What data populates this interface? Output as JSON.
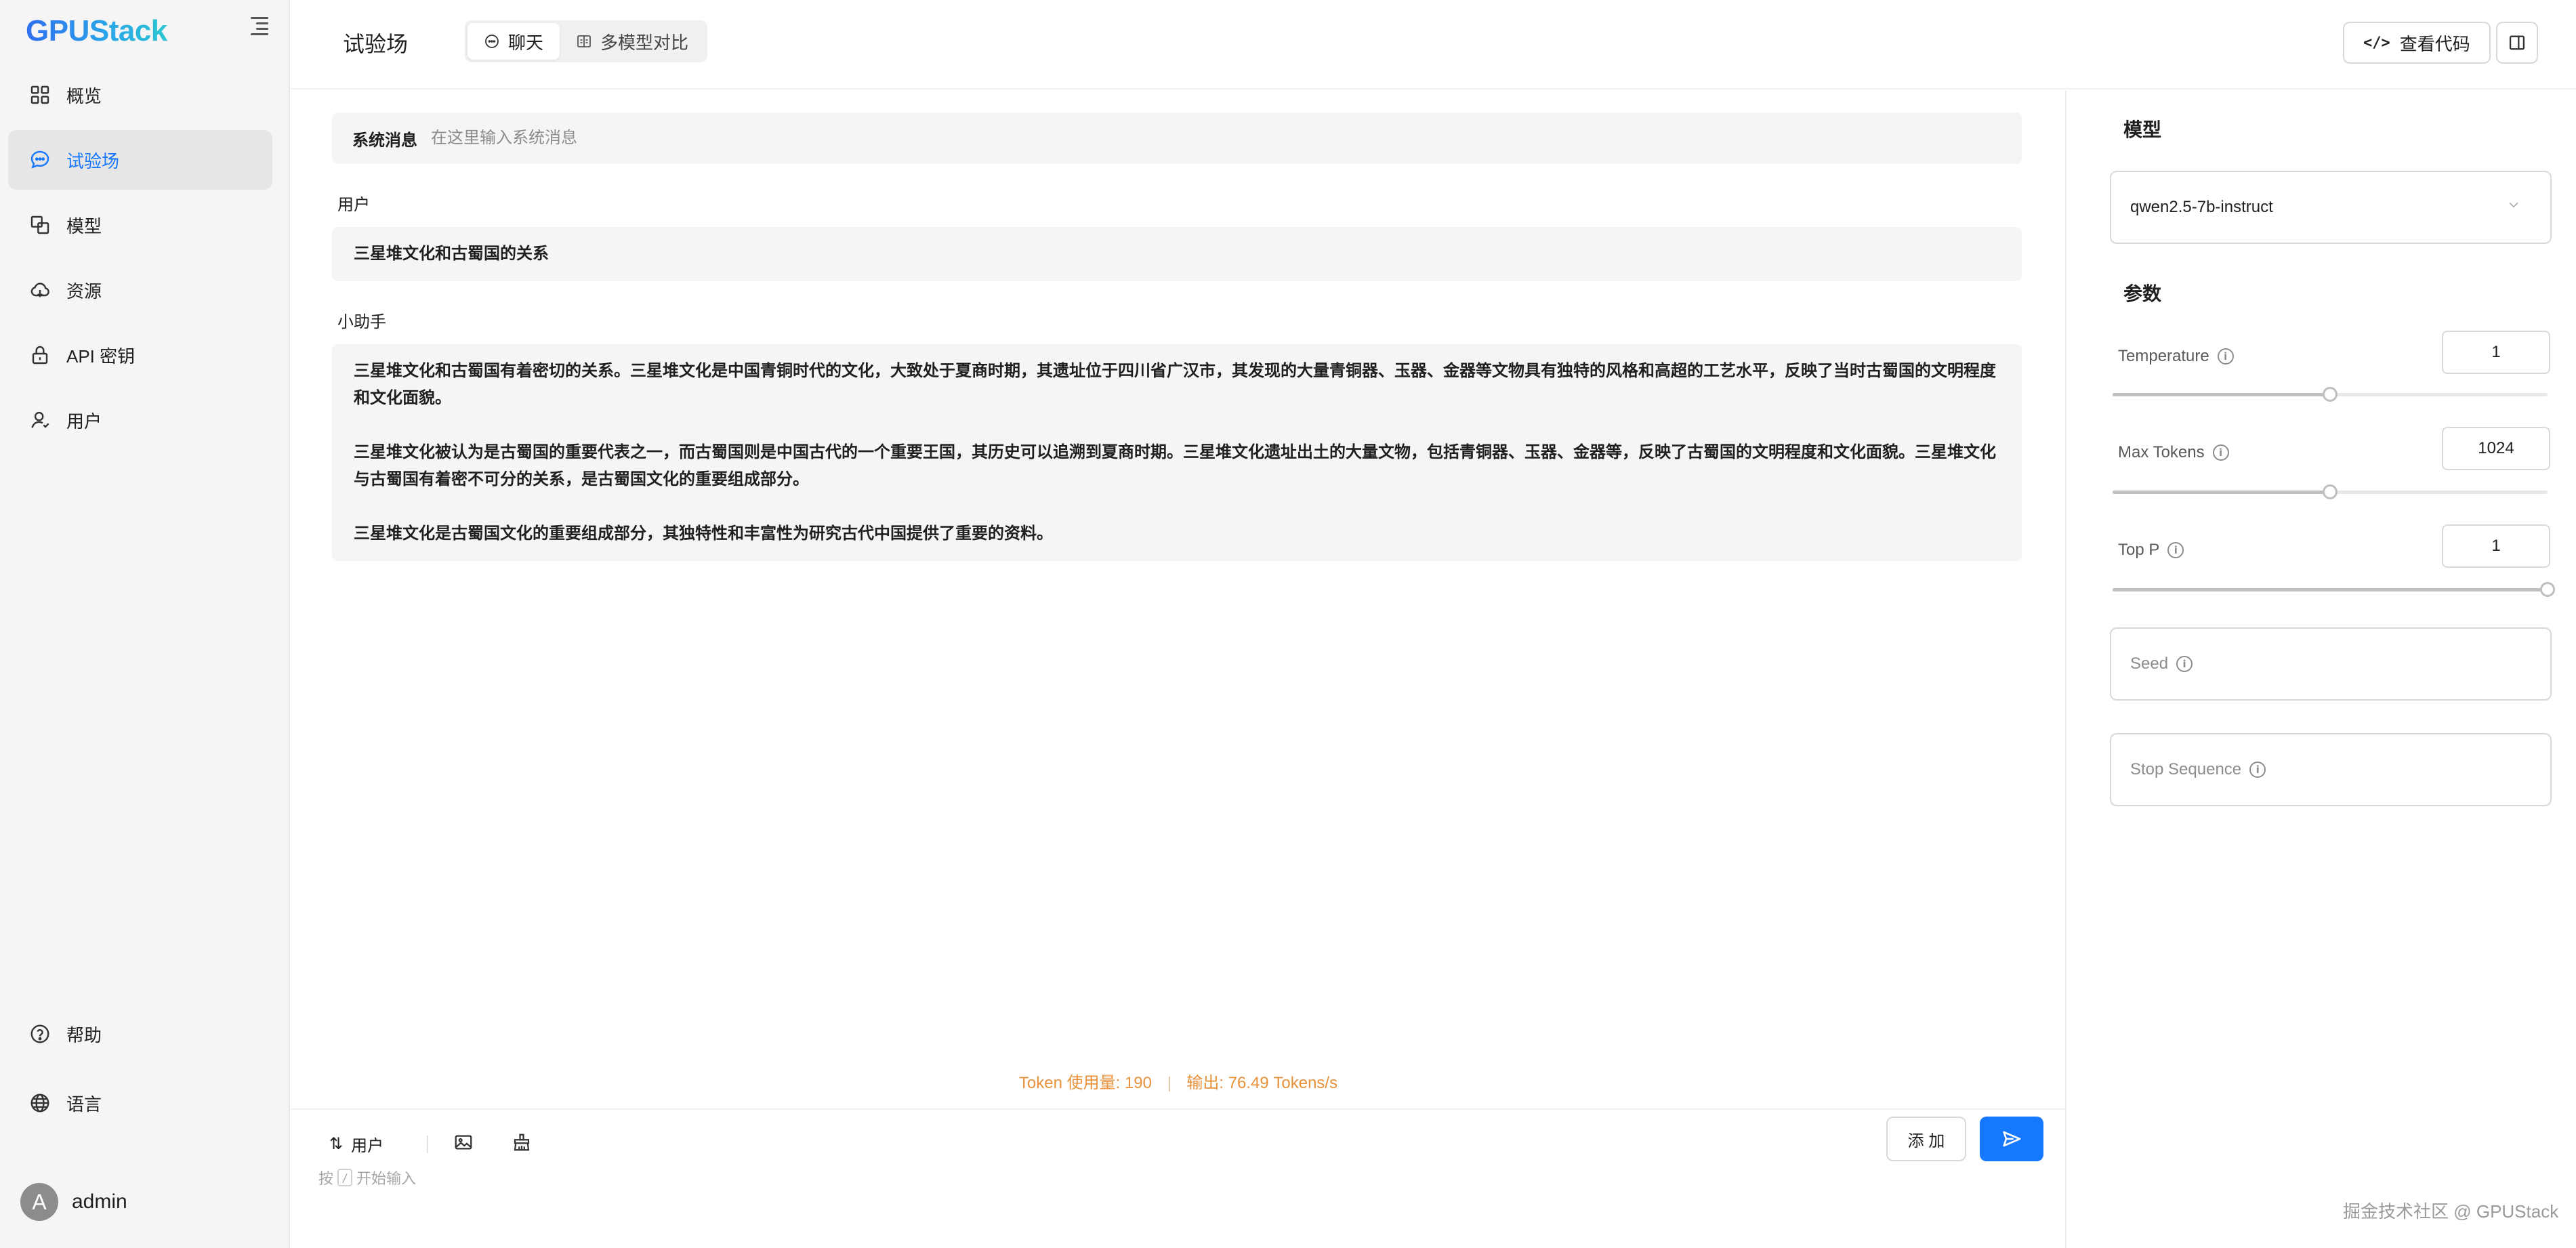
{
  "app": {
    "name": "GPUStack"
  },
  "sidebar": {
    "items": [
      {
        "label": "概览",
        "icon": "dashboard-icon",
        "active": false
      },
      {
        "label": "试验场",
        "icon": "chat-bubble-icon",
        "active": true
      },
      {
        "label": "模型",
        "icon": "model-icon",
        "active": false
      },
      {
        "label": "资源",
        "icon": "cloud-icon",
        "active": false
      },
      {
        "label": "API 密钥",
        "icon": "lock-icon",
        "active": false
      },
      {
        "label": "用户",
        "icon": "user-icon",
        "active": false
      }
    ],
    "bottom": [
      {
        "label": "帮助",
        "icon": "help-icon"
      },
      {
        "label": "语言",
        "icon": "globe-icon"
      }
    ],
    "user": {
      "avatar_letter": "A",
      "name": "admin"
    }
  },
  "header": {
    "title": "试验场",
    "tabs": [
      {
        "label": "聊天",
        "active": true
      },
      {
        "label": "多模型对比",
        "active": false
      }
    ],
    "view_code_label": "查看代码"
  },
  "chat": {
    "system": {
      "label": "系统消息",
      "placeholder": "在这里输入系统消息"
    },
    "user_role": "用户",
    "user_message": "三星堆文化和古蜀国的关系",
    "assistant_role": "小助手",
    "assistant_paragraphs": [
      "三星堆文化和古蜀国有着密切的关系。三星堆文化是中国青铜时代的文化，大致处于夏商时期，其遗址位于四川省广汉市，其发现的大量青铜器、玉器、金器等文物具有独特的风格和高超的工艺水平，反映了当时古蜀国的文明程度和文化面貌。",
      "三星堆文化被认为是古蜀国的重要代表之一，而古蜀国则是中国古代的一个重要王国，其历史可以追溯到夏商时期。三星堆文化遗址出土的大量文物，包括青铜器、玉器、金器等，反映了古蜀国的文明程度和文化面貌。三星堆文化与古蜀国有着密不可分的关系，是古蜀国文化的重要组成部分。",
      "三星堆文化是古蜀国文化的重要组成部分，其独特性和丰富性为研究古代中国提供了重要的资料。"
    ],
    "token_usage": "Token 使用量: 190",
    "output_speed": "输出: 76.49 Tokens/s"
  },
  "input_bar": {
    "role_label": "用户",
    "hint_before": "按",
    "hint_key": "/",
    "hint_after": "开始输入",
    "add_label": "添 加"
  },
  "right_panel": {
    "model_title": "模型",
    "model_value": "qwen2.5-7b-instruct",
    "params_title": "参数",
    "params": [
      {
        "label": "Temperature",
        "value": "1",
        "level": 0.5
      },
      {
        "label": "Max Tokens",
        "value": "1024",
        "level": 0.5
      },
      {
        "label": "Top P",
        "value": "1",
        "level": 1.0
      }
    ],
    "seed_label": "Seed",
    "stop_label": "Stop Sequence"
  },
  "watermark": "掘金技术社区 @ GPUStack",
  "colors": {
    "accent": "#1677ff",
    "token_text": "#e8913a"
  }
}
